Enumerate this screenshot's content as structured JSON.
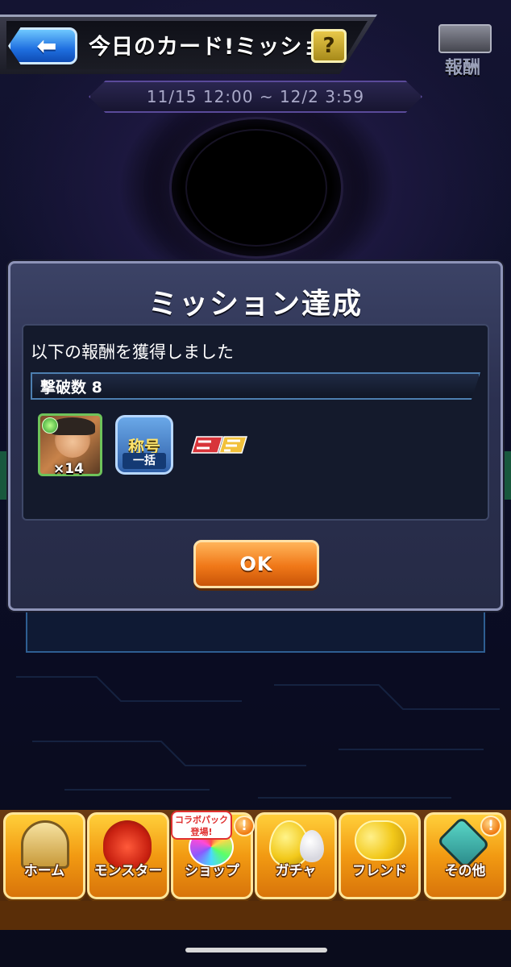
{
  "header": {
    "back_icon": "arrow-left-icon",
    "title": "今日のカード!ミッション",
    "help_label": "?",
    "period": "11/15 12:00 ~ 12/2 3:59",
    "reward_label": "報酬",
    "reward_icon": "briefcase-icon"
  },
  "dialog": {
    "title": "ミッション達成",
    "message": "以下の報酬を獲得しました",
    "mission_name": "撃破数 8",
    "rewards": [
      {
        "type": "monster-card-icon",
        "count_label": "×14"
      },
      {
        "type": "title-badge-icon",
        "top_label": "称号",
        "bottom_label": "一括"
      },
      {
        "type": "sd-logo-icon"
      }
    ],
    "ok_label": "OK"
  },
  "nav": {
    "items": [
      {
        "label": "ホーム",
        "icon": "home-gate-icon"
      },
      {
        "label": "モンスター",
        "icon": "dragon-icon"
      },
      {
        "label": "ショップ",
        "icon": "rainbow-orb-icon",
        "tag": "コラボパック登場!",
        "alert": "!"
      },
      {
        "label": "ガチャ",
        "icon": "egg-icon"
      },
      {
        "label": "フレンド",
        "icon": "friends-balloon-icon"
      },
      {
        "label": "その他",
        "icon": "more-icon",
        "alert": "!"
      }
    ],
    "colors": {
      "nav_gold": "#f29a12",
      "accent_orange": "#f07818",
      "alert_orange": "#f07a10"
    }
  }
}
